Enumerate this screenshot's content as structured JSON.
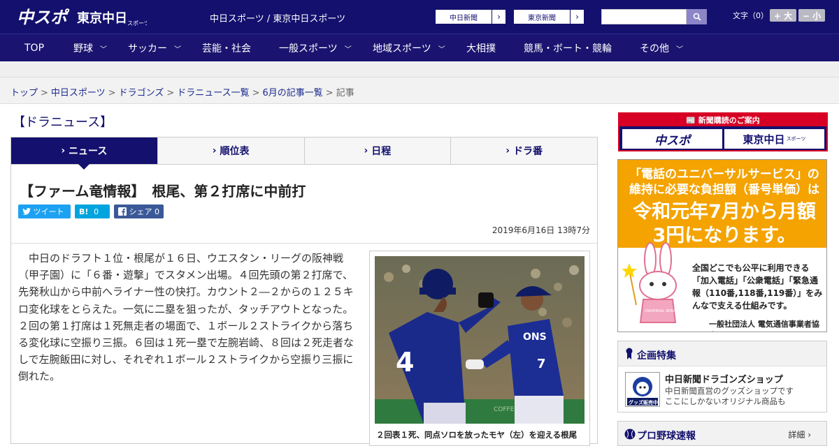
{
  "header": {
    "logo_chunichi": "中スポ",
    "logo_tokyo": "東京中日",
    "logo_tokyo_sub": "スポーツ",
    "site_name": "中日スポーツ / 東京中日スポーツ",
    "paper_links": [
      "中日新聞",
      "東京新聞"
    ],
    "font_size_label": "文字（0）",
    "font_larger": "+ 大",
    "font_smaller": "− 小"
  },
  "nav": [
    "TOP",
    "野球",
    "サッカー",
    "芸能・社会",
    "一般スポーツ",
    "地域スポーツ",
    "大相撲",
    "競馬・ボート・競輪",
    "その他"
  ],
  "breadcrumb": {
    "links": [
      "トップ",
      "中日スポーツ",
      "ドラゴンズ",
      "ドラニュース一覧",
      "6月の記事一覧"
    ],
    "current": "記事"
  },
  "section_title": "【ドラニュース】",
  "tabs": [
    "ニュース",
    "順位表",
    "日程",
    "ドラ番"
  ],
  "article": {
    "headline": "【ファーム竜情報】　根尾、第２打席に中前打",
    "share": {
      "tweet": "ツイート",
      "hatena": "B!",
      "hatena_count": "0",
      "fb": "シェア",
      "fb_count": "0"
    },
    "date": "2019年6月16日 13時7分",
    "body": "中日のドラフト１位・根尾が１６日、ウエスタン・リーグの阪神戦（甲子園）に「６番・遊撃」でスタメン出場。４回先頭の第２打席で、先発秋山から中前へライナー性の快打。カウント２―２からの１２５キロ変化球をとらえた。一気に二塁を狙ったが、タッチアウトとなった。２回の第１打席は１死無走者の場面で、１ボール２ストライクから落ちる変化球に空振り三振。６回は１死一塁で左腕岩崎、８回は２死走者なしで左腕飯田に対し、それぞれ１ボール２ストライクから空振り三振に倒れた。",
    "photo_jersey_left": "4",
    "photo_jersey_right": "7",
    "photo_jersey_right_text": "ONS",
    "photo_bg_text": "COFFEE",
    "caption": "２回表１死、同点ソロを放ったモヤ（左）を迎える根尾"
  },
  "sidebar": {
    "subscribe_head": "新聞購読のご案内",
    "subscribe_logos": [
      "中スポ",
      "東京中日"
    ],
    "subscribe_logo_sub": "スポーツ",
    "ad": {
      "title": "「電話のユニバーサルサービス」の維持に必要な負担額（番号単価）は",
      "big": "令和元年7月から月額3円になります。",
      "text": "全国どこでも公平に利用できる「加入電話」「公衆電話」「緊急通報（110番,118番,119番）」をみんなで支える仕組みです。",
      "org": "一般社団法人 電気通信事業者協会",
      "mascot_label": "UNIVERSAL SERVICE"
    },
    "feature_title": "企画特集",
    "shop_title": "中日新聞ドラゴンズショップ",
    "shop_desc": "中日新聞直営のグッズショップです\nここにしかないオリジナル商品も",
    "shop_badge": "グッズ販売中",
    "baseball_title": "プロ野球速報",
    "baseball_more": "詳細 ›"
  }
}
